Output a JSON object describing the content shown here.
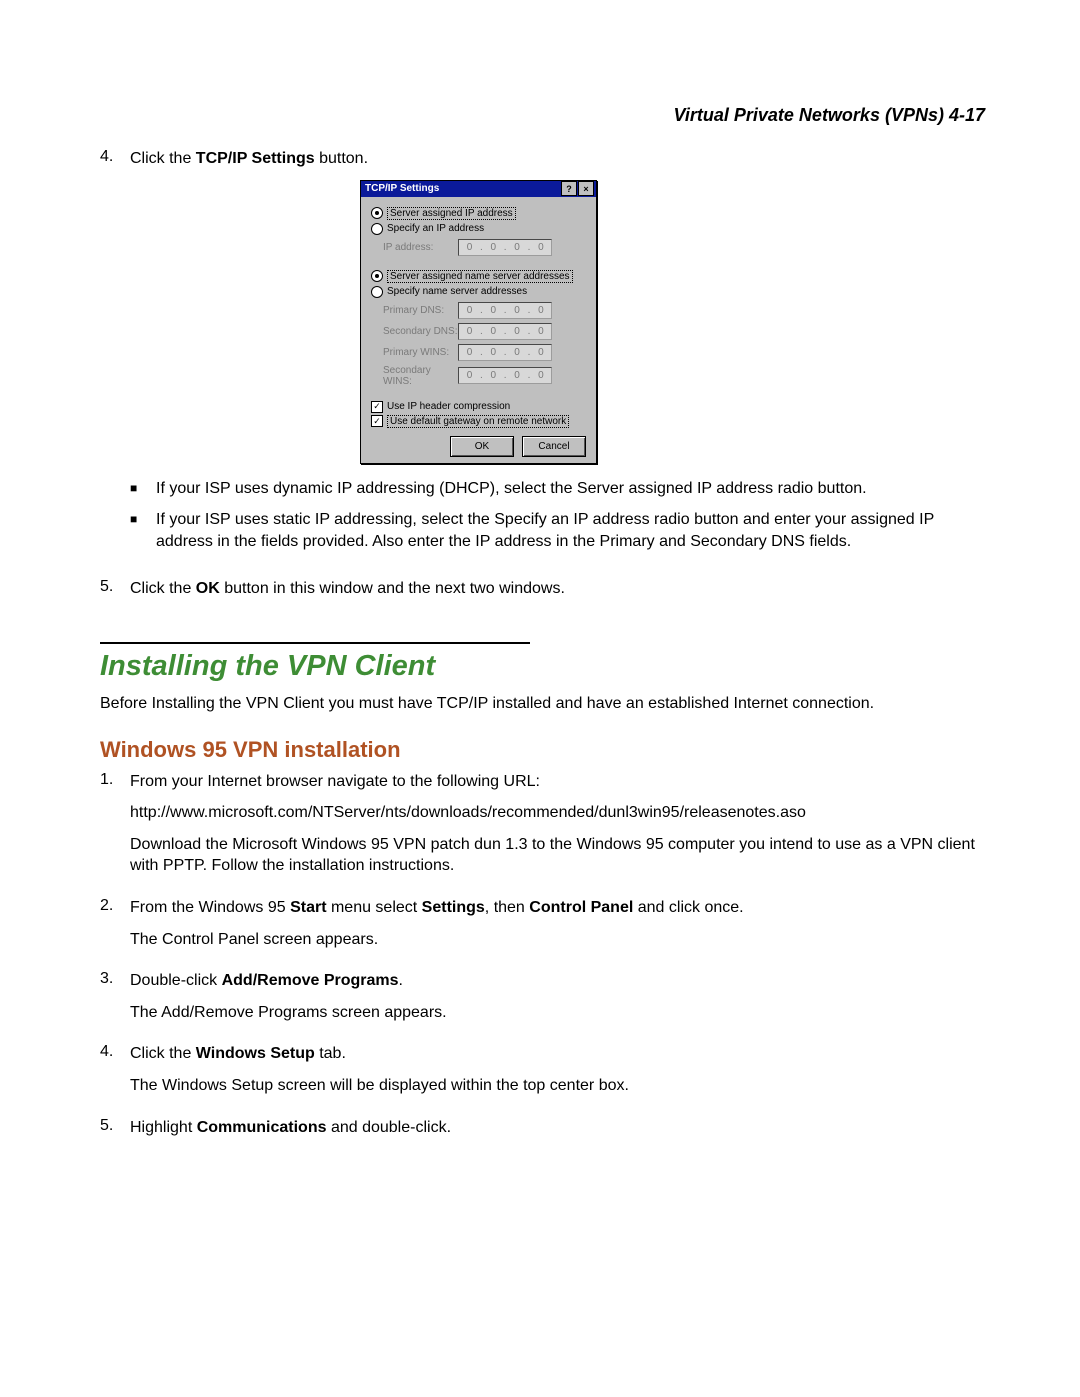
{
  "header": {
    "running": "Virtual Private Networks (VPNs)   4-17"
  },
  "step4": {
    "num": "4.",
    "pre": "Click the ",
    "bold": "TCP/IP Settings",
    "post": " button."
  },
  "dialog": {
    "title": "TCP/IP Settings",
    "help": "?",
    "close": "×",
    "r1": "Server assigned IP address",
    "r2": "Specify an IP address",
    "ip_label": "IP address:",
    "r3": "Server assigned name server addresses",
    "r4": "Specify name server addresses",
    "pdns": "Primary DNS:",
    "sdns": "Secondary DNS:",
    "pwins": "Primary WINS:",
    "swins": "Secondary WINS:",
    "oct": "0",
    "chk1": "Use IP header compression",
    "chk2": "Use default gateway on remote network",
    "ok": "OK",
    "cancel": "Cancel"
  },
  "bul1": "If your ISP uses dynamic IP addressing (DHCP), select the Server assigned IP address radio button.",
  "bul2": "If your ISP uses static IP addressing, select the Specify an IP address radio button and enter your assigned IP address in the fields provided. Also enter the IP address in the Primary and Secondary DNS fields.",
  "step5": {
    "num": "5.",
    "pre": "Click the ",
    "bold": "OK",
    "post": " button in this window and the next two windows."
  },
  "h2": "Installing the VPN Client",
  "lead": "Before Installing the VPN Client you must have TCP/IP installed and have an established Internet connection.",
  "h3": "Windows 95 VPN installation",
  "s1": {
    "num": "1.",
    "a": "From your Internet browser navigate to the following URL:",
    "b": "http://www.microsoft.com/NTServer/nts/downloads/recommended/dunl3win95/releasenotes.aso",
    "c": "Download the Microsoft Windows 95 VPN patch dun 1.3 to the Windows 95 computer you intend to use as a VPN client with PPTP. Follow the installation instructions."
  },
  "s2": {
    "num": "2.",
    "a1": "From the Windows 95 ",
    "b1": "Start",
    "a2": " menu select ",
    "b2": "Settings",
    "a3": ", then ",
    "b3": "Control Panel",
    "a4": " and click once.",
    "sub": "The Control Panel screen appears."
  },
  "s3": {
    "num": "3.",
    "a": "Double-click ",
    "b": "Add/Remove Programs",
    "c": ".",
    "sub": "The Add/Remove Programs screen appears."
  },
  "s4": {
    "num": "4.",
    "a": "Click the ",
    "b": "Windows Setup",
    "c": " tab.",
    "sub": "The Windows Setup screen will be displayed within the top center box."
  },
  "s5": {
    "num": "5.",
    "a": "Highlight ",
    "b": "Communications",
    "c": " and double-click."
  }
}
